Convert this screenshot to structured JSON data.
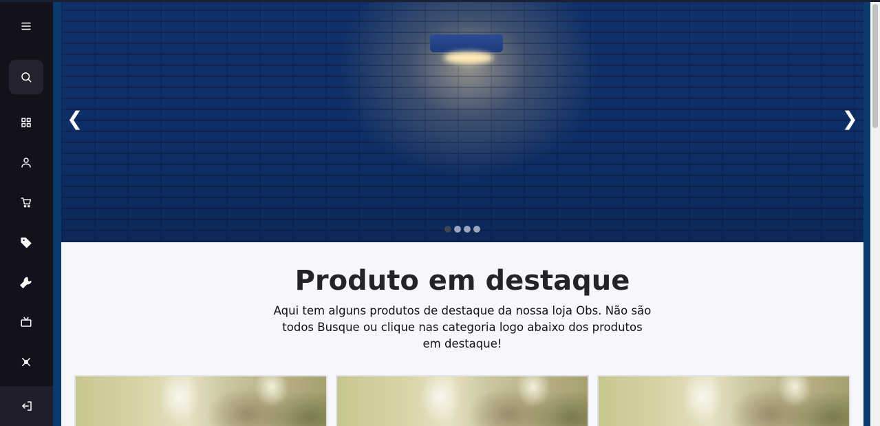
{
  "sidebar": {
    "items": [
      {
        "name": "menu",
        "icon": "menu-icon"
      },
      {
        "name": "search",
        "icon": "search-icon"
      },
      {
        "name": "dashboard",
        "icon": "grid-icon"
      },
      {
        "name": "user",
        "icon": "user-icon"
      },
      {
        "name": "cart",
        "icon": "cart-icon"
      },
      {
        "name": "tag",
        "icon": "tag-icon"
      },
      {
        "name": "tools",
        "icon": "wrench-icon"
      },
      {
        "name": "tv",
        "icon": "tv-icon"
      },
      {
        "name": "settings",
        "icon": "settings-icon"
      }
    ],
    "logout_icon": "logout-icon"
  },
  "carousel": {
    "prev_label": "❮",
    "next_label": "❯",
    "slides": 4,
    "active_slide": 1
  },
  "featured": {
    "title": "Produto em destaque",
    "description": "Aqui tem alguns produtos de destaque da nossa loja Obs. Não são todos Busque ou clique nas categoria logo abaixo dos produtos em destaque!"
  },
  "colors": {
    "sidebar_bg": "#12111c",
    "hero_blue": "#0e2f66",
    "page_bg": "#f5f7fa",
    "text_dark": "#23232a"
  }
}
